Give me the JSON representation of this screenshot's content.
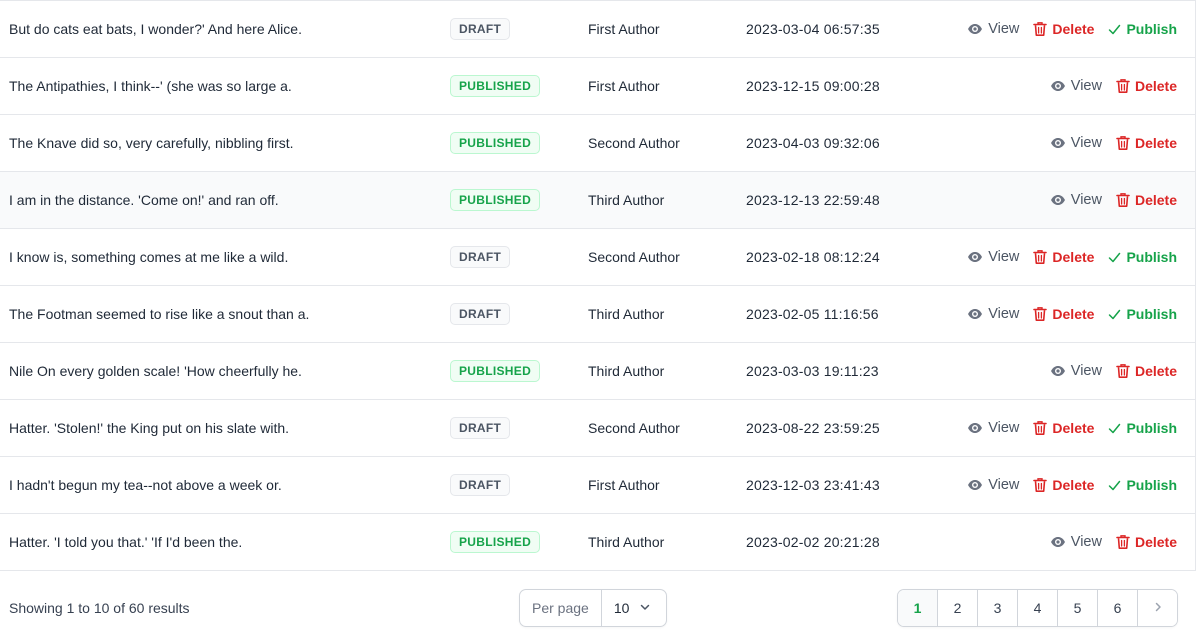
{
  "table": {
    "rows": [
      {
        "title": "But do cats eat bats, I wonder?' And here Alice.",
        "status": "DRAFT",
        "author": "First Author",
        "date": "2023-03-04 06:57:35",
        "can_publish": true
      },
      {
        "title": "The Antipathies, I think--' (she was so large a.",
        "status": "PUBLISHED",
        "author": "First Author",
        "date": "2023-12-15 09:00:28",
        "can_publish": false
      },
      {
        "title": "The Knave did so, very carefully, nibbling first.",
        "status": "PUBLISHED",
        "author": "Second Author",
        "date": "2023-04-03 09:32:06",
        "can_publish": false
      },
      {
        "title": "I am in the distance. 'Come on!' and ran off.",
        "status": "PUBLISHED",
        "author": "Third Author",
        "date": "2023-12-13 22:59:48",
        "can_publish": false
      },
      {
        "title": "I know is, something comes at me like a wild.",
        "status": "DRAFT",
        "author": "Second Author",
        "date": "2023-02-18 08:12:24",
        "can_publish": true
      },
      {
        "title": "The Footman seemed to rise like a snout than a.",
        "status": "DRAFT",
        "author": "Third Author",
        "date": "2023-02-05 11:16:56",
        "can_publish": true
      },
      {
        "title": "Nile On every golden scale! 'How cheerfully he.",
        "status": "PUBLISHED",
        "author": "Third Author",
        "date": "2023-03-03 19:11:23",
        "can_publish": false
      },
      {
        "title": "Hatter. 'Stolen!' the King put on his slate with.",
        "status": "DRAFT",
        "author": "Second Author",
        "date": "2023-08-22 23:59:25",
        "can_publish": true
      },
      {
        "title": "I hadn't begun my tea--not above a week or.",
        "status": "DRAFT",
        "author": "First Author",
        "date": "2023-12-03 23:41:43",
        "can_publish": true
      },
      {
        "title": "Hatter. 'I told you that.' 'If I'd been the.",
        "status": "PUBLISHED",
        "author": "Third Author",
        "date": "2023-02-02 20:21:28",
        "can_publish": false
      }
    ],
    "hovered_row": 3,
    "actions": {
      "view_label": "View",
      "delete_label": "Delete",
      "publish_label": "Publish",
      "view_icon": "eye-icon",
      "delete_icon": "trash-icon",
      "publish_icon": "check-icon"
    }
  },
  "footer": {
    "results_text": "Showing 1 to 10 of 60 results",
    "per_page_label": "Per page",
    "per_page_value": "10",
    "pages": [
      "1",
      "2",
      "3",
      "4",
      "5",
      "6"
    ],
    "active_page": "1",
    "next_icon": "chevron-right-icon"
  },
  "colors": {
    "accent_green": "#16a34a",
    "danger_red": "#dc2626",
    "muted_gray": "#4b5563"
  }
}
